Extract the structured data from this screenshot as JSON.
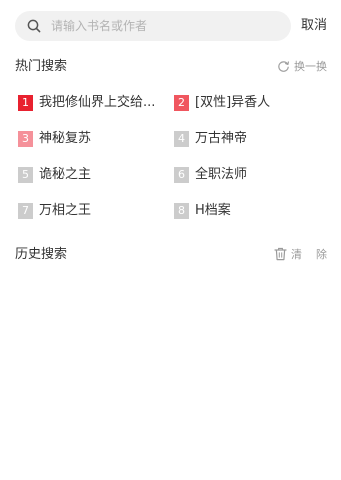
{
  "search": {
    "placeholder": "请输入书名或作者",
    "cancel_label": "取消"
  },
  "hot": {
    "title": "热门搜索",
    "refresh_label": "换一换",
    "items": [
      {
        "rank": "1",
        "label": "我把修仙界上交给...",
        "badge_color": "#e8212f"
      },
      {
        "rank": "2",
        "label": "[双性]异香人",
        "badge_color": "#f0565f"
      },
      {
        "rank": "3",
        "label": "神秘复苏",
        "badge_color": "#f5919a"
      },
      {
        "rank": "4",
        "label": "万古神帝",
        "badge_color": "#cccccc"
      },
      {
        "rank": "5",
        "label": "诡秘之主",
        "badge_color": "#cccccc"
      },
      {
        "rank": "6",
        "label": "全职法师",
        "badge_color": "#cccccc"
      },
      {
        "rank": "7",
        "label": "万相之王",
        "badge_color": "#cccccc"
      },
      {
        "rank": "8",
        "label": "H档案",
        "badge_color": "#cccccc"
      }
    ]
  },
  "history": {
    "title": "历史搜索",
    "clear_label_1": "清",
    "clear_label_2": "除"
  }
}
